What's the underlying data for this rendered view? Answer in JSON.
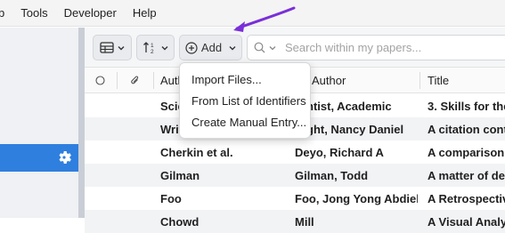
{
  "menubar": {
    "items": [
      "b",
      "Tools",
      "Developer",
      "Help"
    ]
  },
  "toolbar": {
    "add_label": "Add",
    "search_placeholder": "Search within my papers..."
  },
  "add_menu": {
    "items": [
      "Import Files...",
      "From List of Identifiers",
      "Create Manual Entry..."
    ]
  },
  "table": {
    "headers": {
      "author": "Auth",
      "first_author": "Author",
      "title": "Title"
    },
    "rows": [
      {
        "author": "Scie",
        "first_author": "ntist, Academic",
        "title": "3. Skills for the"
      },
      {
        "author": "Writ",
        "first_author": "ght, Nancy Daniel",
        "title": "A citation conte"
      },
      {
        "author": "Cherkin et al.",
        "first_author": "Deyo, Richard A",
        "title": "A comparison o"
      },
      {
        "author": "Gilman",
        "first_author": "Gilman, Todd",
        "title": "A matter of deg"
      },
      {
        "author": "Foo",
        "first_author": "Foo, Jong Yong Abdiel",
        "title": "A Retrospective"
      },
      {
        "author": "Chowd",
        "first_author": "Mill",
        "title": "A Visual Analyti"
      }
    ]
  },
  "colors": {
    "accent": "#2f7fdf",
    "arrow": "#7a2fd8"
  }
}
